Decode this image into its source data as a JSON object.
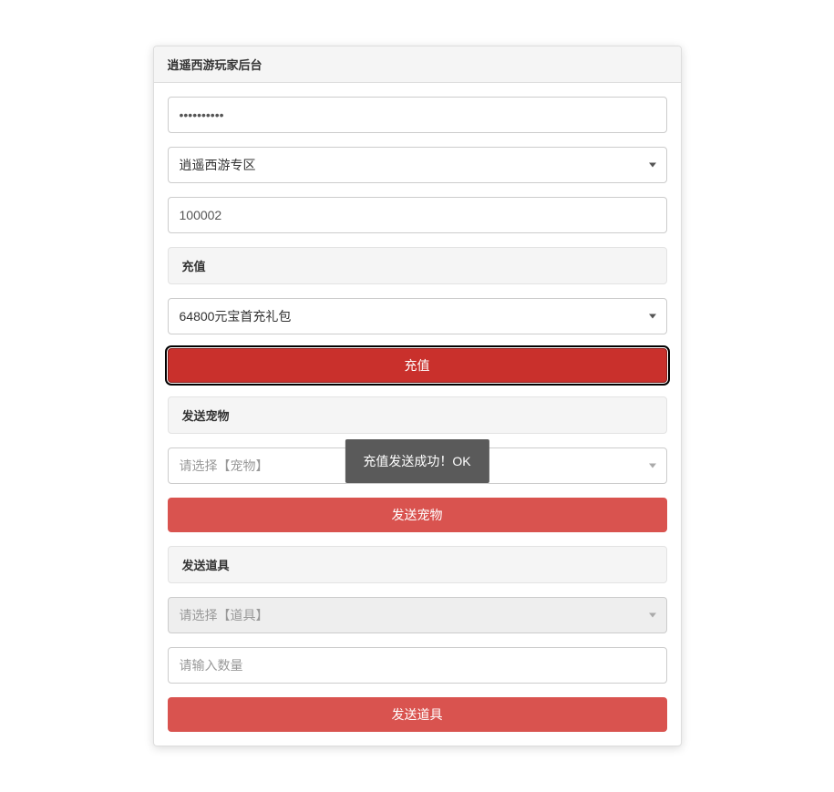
{
  "panel": {
    "title": "逍遥西游玩家后台"
  },
  "password": {
    "value": "••••••••••"
  },
  "zone_select": {
    "value": "逍遥西游专区"
  },
  "player_id": {
    "value": "100002"
  },
  "recharge": {
    "header": "充值",
    "package_value": "64800元宝首充礼包",
    "button": "充值"
  },
  "pet": {
    "header": "发送宠物",
    "select_placeholder": "请选择【宠物】",
    "button": "发送宠物"
  },
  "item": {
    "header": "发送道具",
    "select_placeholder": "请选择【道具】",
    "qty_placeholder": "请输入数量",
    "button": "发送道具"
  },
  "toast": {
    "message": "充值发送成功！OK"
  }
}
